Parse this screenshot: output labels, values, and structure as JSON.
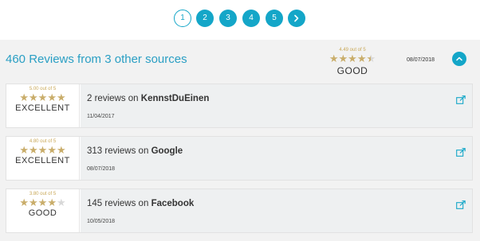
{
  "pagination": {
    "pages": [
      "1",
      "2",
      "3",
      "4",
      "5"
    ],
    "current": "1",
    "next_icon": "chevron-right-icon"
  },
  "summary": {
    "title": "460 Reviews from 3 other sources",
    "score_text": "4.49 out of 5",
    "rating": 4.49,
    "verdict": "GOOD",
    "date": "08/07/2018"
  },
  "sources": [
    {
      "score_text": "5.00 out of 5",
      "rating": 5.0,
      "verdict": "EXCELLENT",
      "count_text": "2 reviews on",
      "name": "KennstDuEinen",
      "date": "11/04/2017"
    },
    {
      "score_text": "4.80 out of 5",
      "rating": 4.8,
      "verdict": "EXCELLENT",
      "count_text": "313 reviews on",
      "name": "Google",
      "date": "08/07/2018"
    },
    {
      "score_text": "3.80 out of 5",
      "rating": 3.8,
      "verdict": "GOOD",
      "count_text": "145 reviews on",
      "name": "Facebook",
      "date": "10/05/2018"
    }
  ],
  "colors": {
    "accent": "#14a6c8",
    "star": "#c9ad6a",
    "star_empty": "#d8d8d8"
  }
}
